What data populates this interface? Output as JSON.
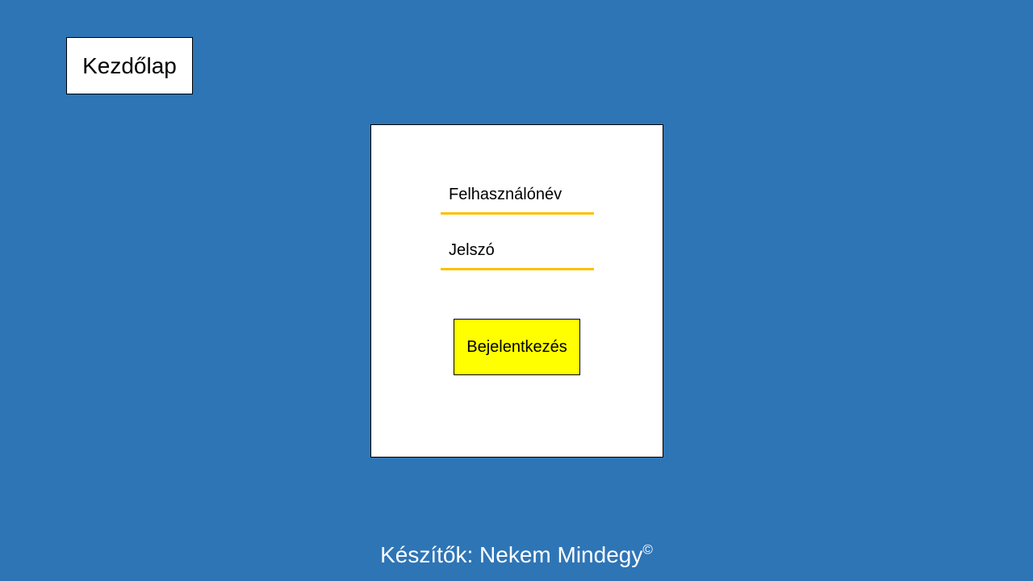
{
  "nav": {
    "home_label": "Kezdőlap"
  },
  "login": {
    "username_label": "Felhasználónév",
    "password_label": "Jelszó",
    "submit_label": "Bejelentkezés"
  },
  "footer": {
    "credits": "Készítők: Nekem Mindegy",
    "copyright_symbol": "©"
  },
  "colors": {
    "background": "#2e75b6",
    "field_underline": "#ffc000",
    "button": "#ffff00"
  }
}
